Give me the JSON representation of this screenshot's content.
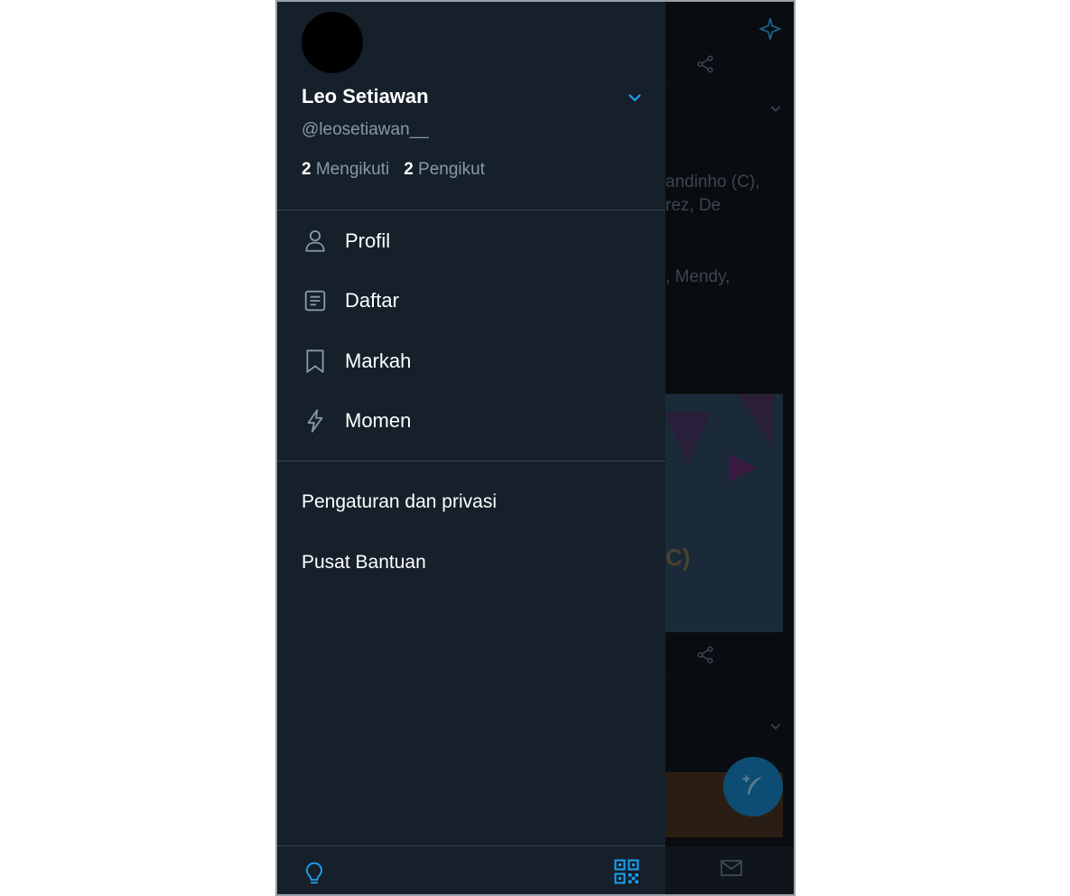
{
  "colors": {
    "drawer_bg": "#15202b",
    "accent": "#1da1f2",
    "secondary_text": "#8899a6",
    "divider": "#38444d"
  },
  "profile": {
    "name": "Leo Setiawan",
    "handle": "@leosetiawan__",
    "following_count": "2",
    "following_label": "Mengikuti",
    "followers_count": "2",
    "followers_label": "Pengikut"
  },
  "menu": [
    {
      "label": "Profil",
      "icon": "person-icon"
    },
    {
      "label": "Daftar",
      "icon": "list-icon"
    },
    {
      "label": "Markah",
      "icon": "bookmark-icon"
    },
    {
      "label": "Momen",
      "icon": "lightning-icon"
    }
  ],
  "secondary_menu": [
    {
      "label": "Pengaturan dan privasi"
    },
    {
      "label": "Pusat Bantuan"
    }
  ],
  "bottom_bar": {
    "left_icon": "lightbulb-icon",
    "right_icon": "qr-code-icon"
  },
  "background_timeline": {
    "text_lines": [
      "andinho (C),",
      "rez, De",
      ", Mendy,"
    ],
    "image_text": "C)"
  }
}
